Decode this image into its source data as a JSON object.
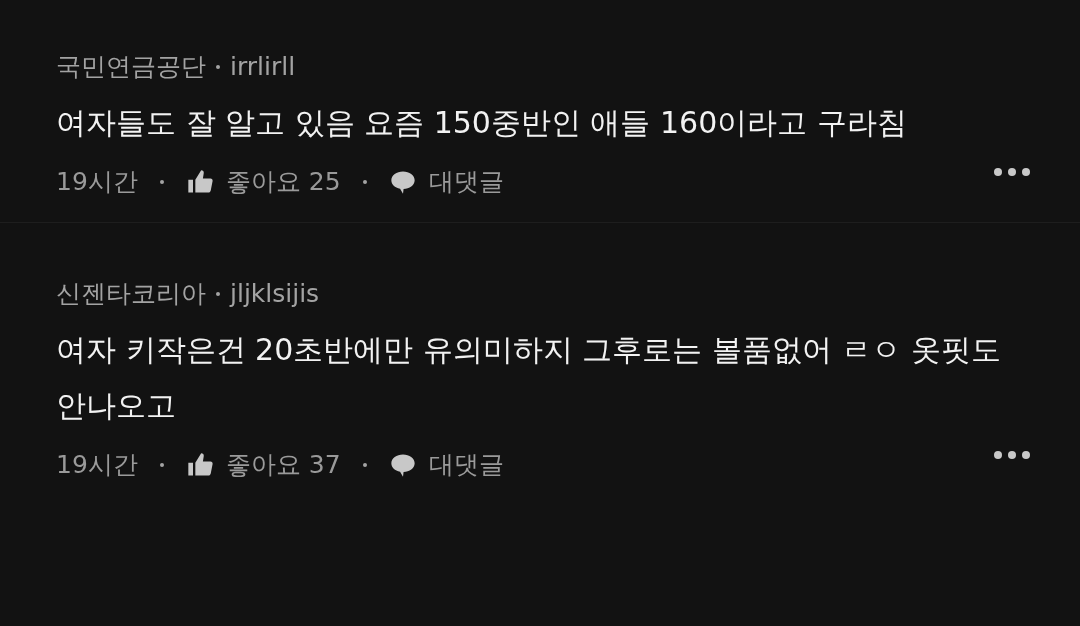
{
  "comments": [
    {
      "author": "국민연금공단",
      "user_id": "irrlirll",
      "text": "여자들도 잘 알고 있음 요즘 150중반인 애들 160이라고 구라침",
      "time": "19시간",
      "likes": "좋아요 25",
      "reply": "대댓글"
    },
    {
      "author": "신젠타코리아",
      "user_id": "jljklsijis",
      "text": "여자 키작은건 20초반에만 유의미하지 그후로는 볼품없어 ㄹㅇ 옷핏도 안나오고",
      "time": "19시간",
      "likes": "좋아요 37",
      "reply": "대댓글"
    }
  ]
}
